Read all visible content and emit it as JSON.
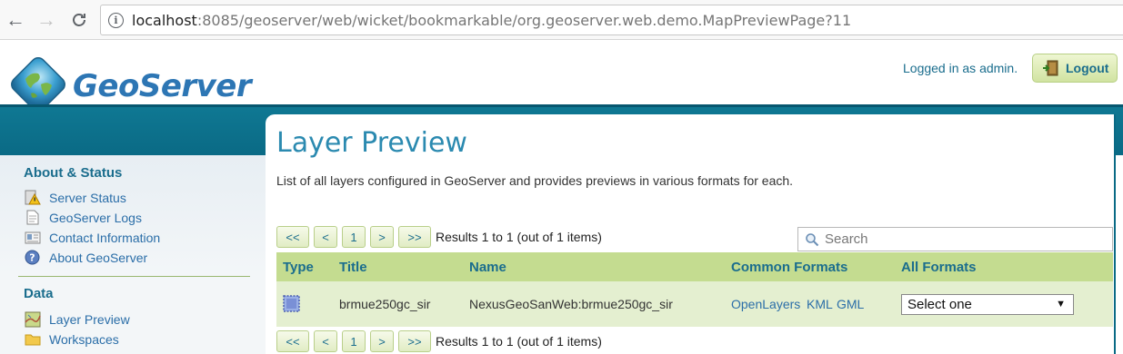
{
  "browser": {
    "url_host": "localhost",
    "url_rest": ":8085/geoserver/web/wicket/bookmarkable/org.geoserver.web.demo.MapPreviewPage?11"
  },
  "header": {
    "logo_text": "GeoServer",
    "logged_in": "Logged in as admin.",
    "logout_label": "Logout"
  },
  "sidebar": {
    "about_heading": "About & Status",
    "about_items": [
      {
        "label": "Server Status",
        "icon": "server-status-icon"
      },
      {
        "label": "GeoServer Logs",
        "icon": "document-icon"
      },
      {
        "label": "Contact Information",
        "icon": "contact-card-icon"
      },
      {
        "label": "About GeoServer",
        "icon": "info-help-icon"
      }
    ],
    "data_heading": "Data",
    "data_items": [
      {
        "label": "Layer Preview",
        "icon": "map-preview-icon"
      },
      {
        "label": "Workspaces",
        "icon": "folder-icon"
      }
    ]
  },
  "main": {
    "title": "Layer Preview",
    "description": "List of all layers configured in GeoServer and provides previews in various formats for each.",
    "pager": {
      "first": "<<",
      "prev": "<",
      "page": "1",
      "next": ">",
      "last": ">>",
      "results": "Results 1 to 1 (out of 1 items)"
    },
    "search_placeholder": "Search",
    "table": {
      "headers": [
        "Type",
        "Title",
        "Name",
        "Common Formats",
        "All Formats"
      ],
      "rows": [
        {
          "type_icon": "polygon-layer-icon",
          "title": "brmue250gc_sir",
          "name": "NexusGeoSanWeb:brmue250gc_sir",
          "formats": [
            "OpenLayers",
            "KML",
            "GML"
          ],
          "all_formats_selected": "Select one"
        }
      ]
    }
  },
  "colors": {
    "accent_teal": "#0a6a85",
    "link_blue": "#2b6ea8",
    "table_header": "#c4dc90",
    "table_row": "#e4efd0"
  }
}
